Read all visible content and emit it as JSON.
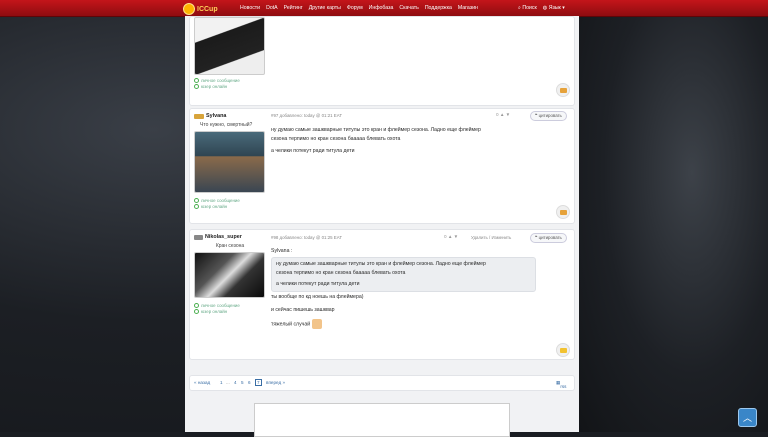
{
  "header": {
    "logo": "ICCup",
    "nav": [
      "Новости",
      "DotA",
      "Рейтинг",
      "Другие карты",
      "Форум",
      "Инфобаза",
      "Скачать",
      "Поддержка",
      "Магазин"
    ],
    "search": "Поиск",
    "language": "Язык"
  },
  "post0": {
    "links": [
      "личное сообщение",
      "юзер онлайн"
    ]
  },
  "post1": {
    "username": "Sylvana",
    "subtitle": "Что нужно, смертный?",
    "links": [
      "личное сообщение",
      "юзер онлайн"
    ],
    "meta": "#97 добавлено: today @ 01:21 EAT",
    "rating": "0",
    "quote_label": "цитировать",
    "lines": [
      "ну думаю самые зашкварные титулы это кран и флеймер сезона. Ладно еще флеймер",
      "сезона терпимо но кран сезона бааааа блевать охота",
      "а челики потекут ради титула дети"
    ]
  },
  "post2": {
    "username": "Nikolas_super",
    "subtitle": "Кран сезона",
    "links": [
      "личное сообщение",
      "юзер онлайн"
    ],
    "meta": "#98 добавлено: today @ 01:25 EAT",
    "rating": "0",
    "delete_label": "Удалить",
    "edit_label": "Изменить",
    "quote_label": "цитировать",
    "quoted_author": "Sylvana :",
    "quote_lines": [
      "ну думаю самые зашкварные титулы это кран и флеймер сезона. Ладно еще флеймер",
      "сезона терпимо но кран сезона бааааа блевать охота",
      "а челики потекут ради титула дети"
    ],
    "lines": [
      "ты вообще по кд ноешь на флеймера)",
      "и сейчас пишешь зашквар",
      "тяжелый случай"
    ]
  },
  "pager": {
    "back": "« назад",
    "pages": [
      "1",
      "...",
      "4",
      "5",
      "6",
      "7"
    ],
    "forward": "вперед »",
    "rss": "rss"
  },
  "colors": {
    "header_red": "#c4151a",
    "link": "#3a6ea5",
    "accent_gold": "#e6a23a"
  }
}
